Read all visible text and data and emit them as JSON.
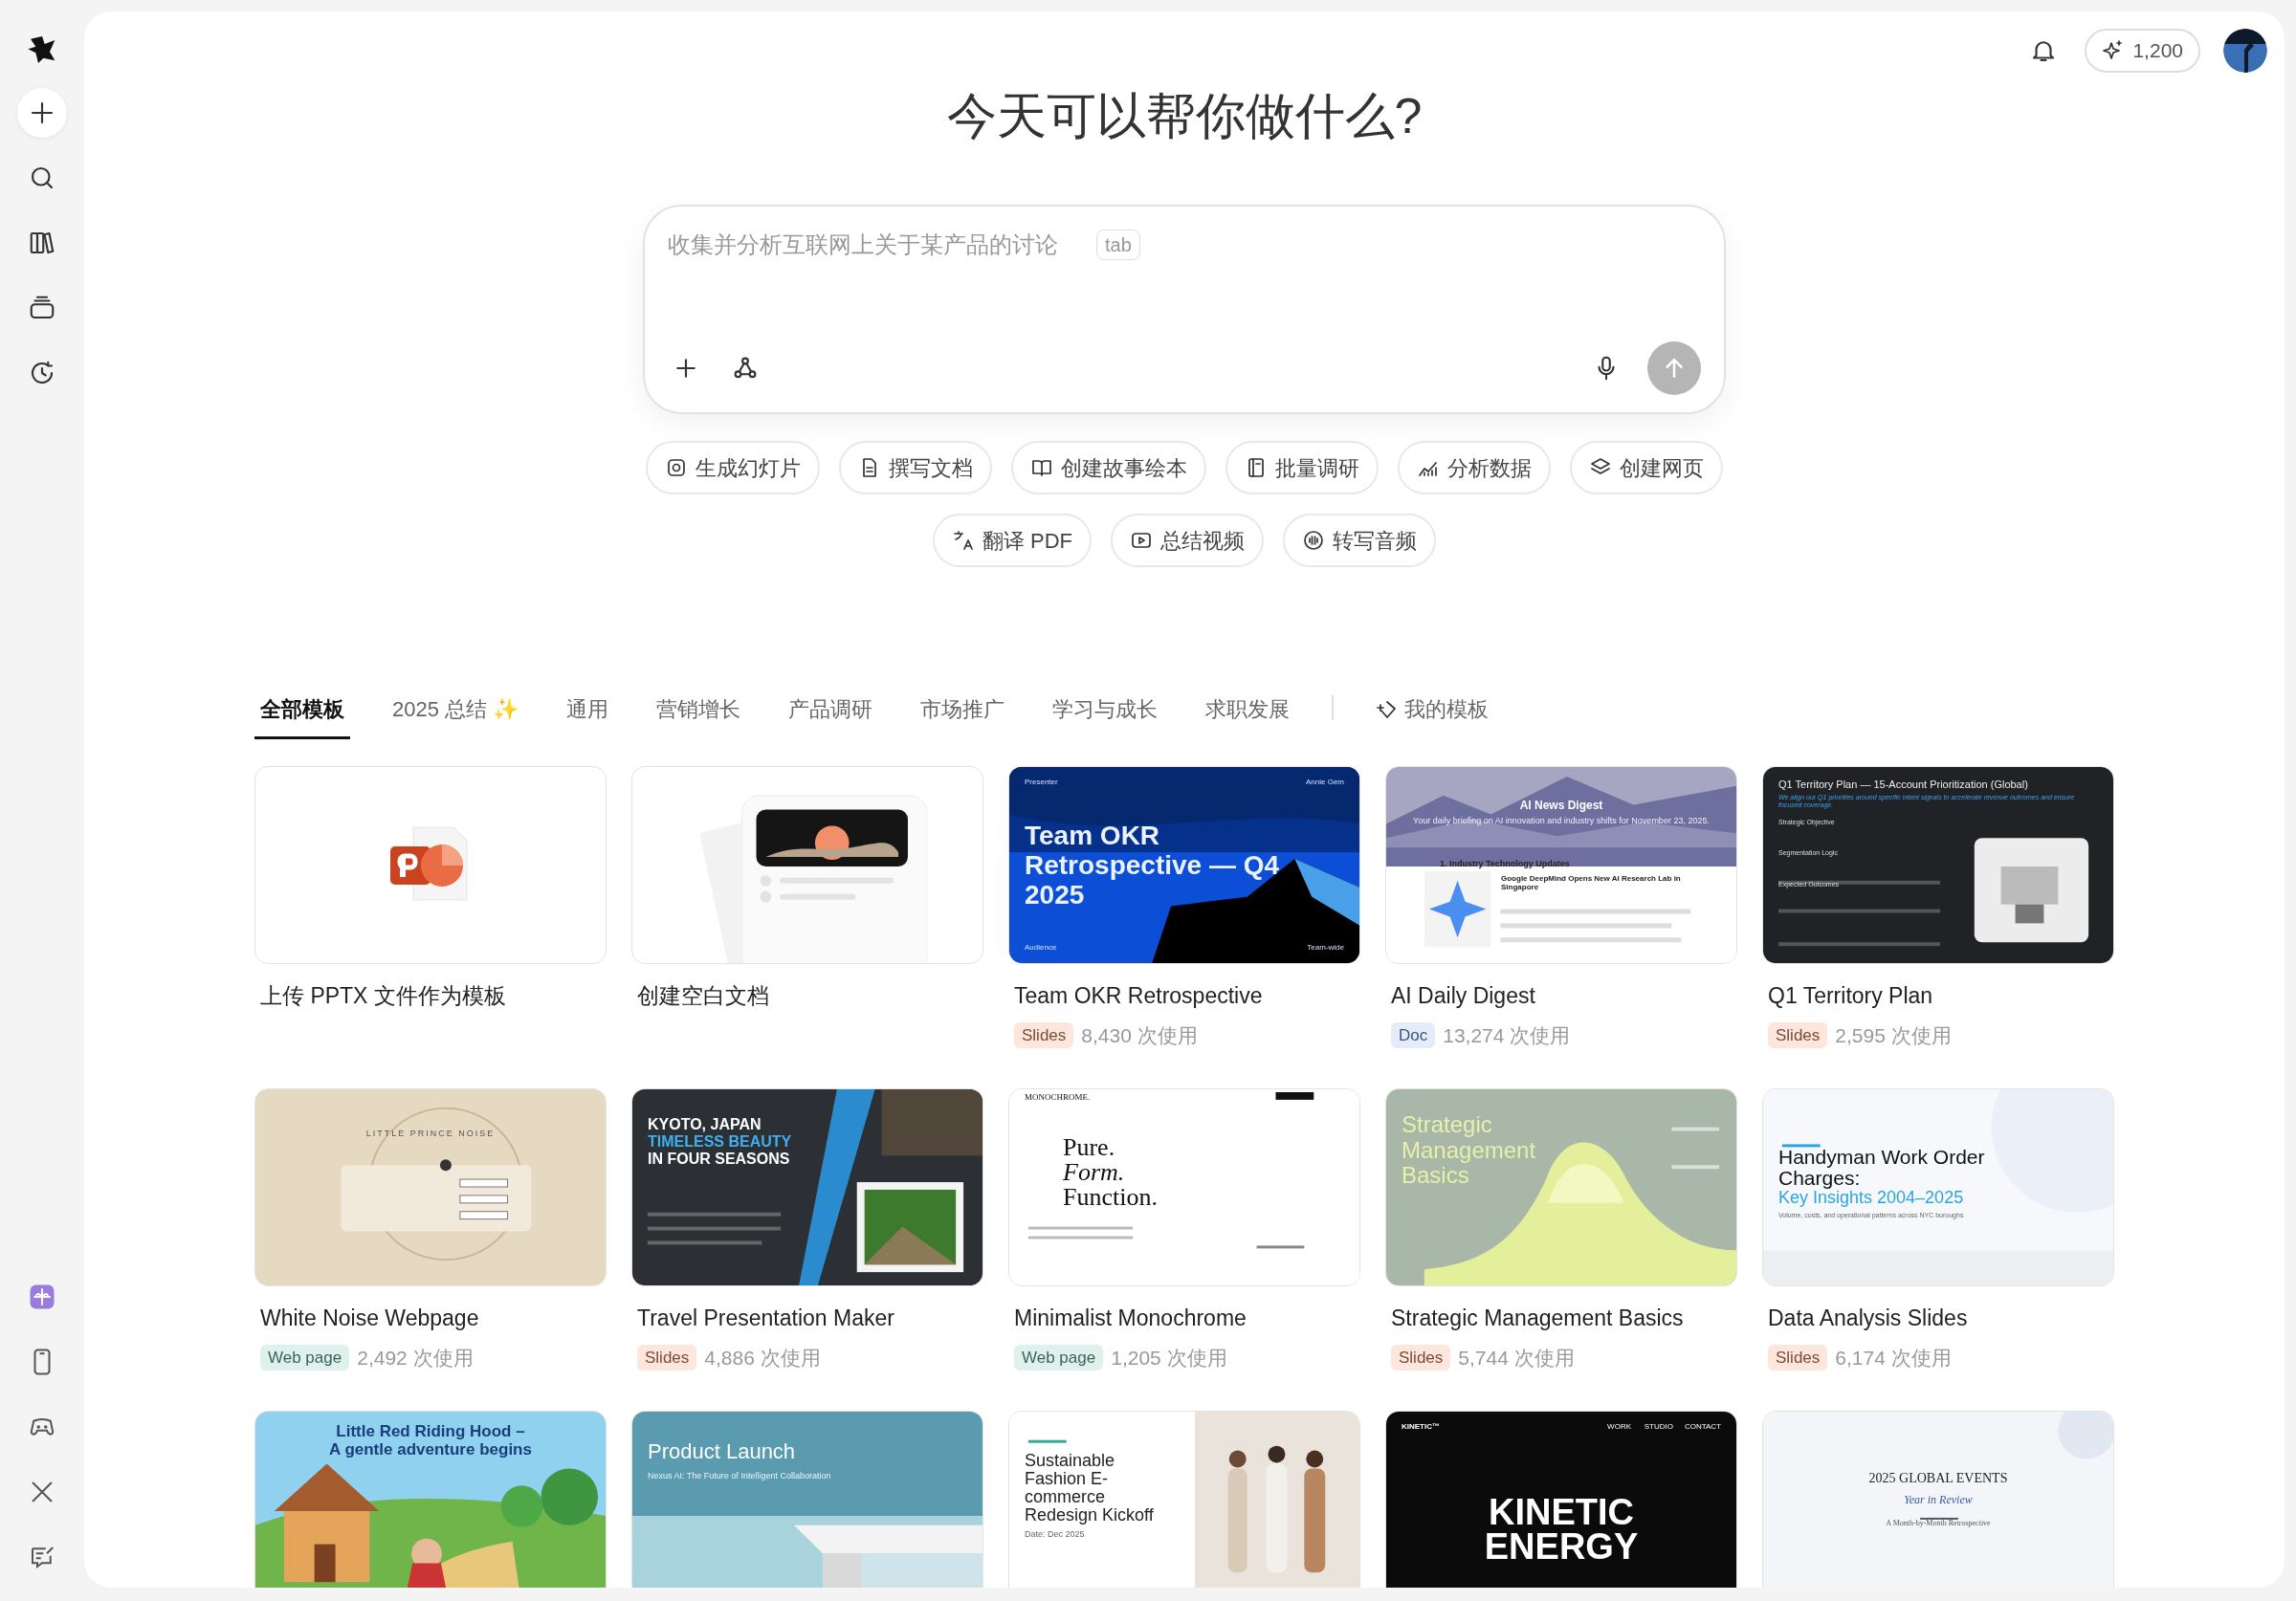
{
  "sidebar": {
    "top": [
      {
        "kind": "logo"
      },
      {
        "kind": "new"
      },
      {
        "kind": "search"
      },
      {
        "kind": "library"
      },
      {
        "kind": "stack"
      },
      {
        "kind": "history"
      }
    ],
    "bottom": [
      {
        "kind": "gift"
      },
      {
        "kind": "phone"
      },
      {
        "kind": "controller"
      },
      {
        "kind": "x"
      },
      {
        "kind": "feedback"
      }
    ]
  },
  "header": {
    "credits": "1,200"
  },
  "heading": "今天可以帮你做什么?",
  "prompt": {
    "placeholder": "收集并分析互联网上关于某产品的讨论",
    "hint_key": "tab"
  },
  "actions": [
    [
      {
        "label": "生成幻灯片",
        "kind": "slides"
      },
      {
        "label": "撰写文档",
        "kind": "doc"
      },
      {
        "label": "创建故事绘本",
        "kind": "story"
      },
      {
        "label": "批量调研",
        "kind": "research"
      },
      {
        "label": "分析数据",
        "kind": "chart"
      },
      {
        "label": "创建网页",
        "kind": "web"
      }
    ],
    [
      {
        "label": "翻译 PDF",
        "kind": "translate"
      },
      {
        "label": "总结视频",
        "kind": "video"
      },
      {
        "label": "转写音频",
        "kind": "audio"
      }
    ]
  ],
  "tabs": [
    {
      "label": "全部模板",
      "selected": true
    },
    {
      "label": "2025 总结 ✨",
      "selected": false
    },
    {
      "label": "通用",
      "selected": false
    },
    {
      "label": "营销增长",
      "selected": false
    },
    {
      "label": "产品调研",
      "selected": false
    },
    {
      "label": "市场推广",
      "selected": false
    },
    {
      "label": "学习与成长",
      "selected": false
    },
    {
      "label": "求职发展",
      "selected": false
    },
    {
      "label": "我的模板",
      "selected": false,
      "kind": "mine"
    }
  ],
  "templates": [
    {
      "title": "上传 PPTX 文件作为模板",
      "thumb": {
        "kind": "upload"
      }
    },
    {
      "title": "创建空白文档",
      "thumb": {
        "kind": "blank"
      }
    },
    {
      "title": "Team OKR Retrospective",
      "tag": {
        "label": "Slides",
        "kind": "slides"
      },
      "uses": "8,430 次使用",
      "thumb": {
        "kind": "okr",
        "lines": [
          "Presenter",
          "Annie Gem",
          "Team OKR Retrospective — Q4 2025",
          "Audience",
          "Team-wide"
        ]
      }
    },
    {
      "title": "AI Daily Digest",
      "tag": {
        "label": "Doc",
        "kind": "doc"
      },
      "uses": "13,274 次使用",
      "thumb": {
        "kind": "digest",
        "lines": [
          "AI News Digest",
          "Your daily briefing on AI innovation and industry shifts for November 23, 2025.",
          "1. Industry Technology Updates",
          "Google DeepMind Opens New AI Research Lab in Singapore"
        ]
      }
    },
    {
      "title": "Q1 Territory Plan",
      "tag": {
        "label": "Slides",
        "kind": "slides"
      },
      "uses": "2,595 次使用",
      "thumb": {
        "kind": "territory",
        "lines": [
          "Q1 Territory Plan — 15-Account Prioritization (Global)",
          "We align our Q1 priorities around specific intent signals to accelerate revenue outcomes and ensure focused coverage.",
          "Strategic Objective",
          "Segmentation Logic",
          "Expected Outcomes"
        ]
      }
    },
    {
      "title": "White Noise Webpage",
      "tag": {
        "label": "Web page",
        "kind": "web"
      },
      "uses": "2,492 次使用",
      "thumb": {
        "kind": "paper",
        "lines": [
          "LITTLE PRINCE NOISE"
        ]
      }
    },
    {
      "title": "Travel Presentation Maker",
      "tag": {
        "label": "Slides",
        "kind": "slides"
      },
      "uses": "4,886 次使用",
      "thumb": {
        "kind": "kyoto",
        "lines": [
          "KYOTO, JAPAN",
          "TIMELESS BEAUTY",
          "IN FOUR SEASONS"
        ]
      }
    },
    {
      "title": "Minimalist Monochrome",
      "tag": {
        "label": "Web page",
        "kind": "web"
      },
      "uses": "1,205 次使用",
      "thumb": {
        "kind": "mono",
        "lines": [
          "MONOCHROME.",
          "Pure.",
          "Form.",
          "Function."
        ]
      }
    },
    {
      "title": "Strategic Management Basics",
      "tag": {
        "label": "Slides",
        "kind": "slides"
      },
      "uses": "5,744 次使用",
      "thumb": {
        "kind": "strategy",
        "lines": [
          "Strategic Management Basics"
        ]
      }
    },
    {
      "title": "Data Analysis Slides",
      "tag": {
        "label": "Slides",
        "kind": "slides"
      },
      "uses": "6,174 次使用",
      "thumb": {
        "kind": "handyman",
        "lines": [
          "Handyman Work Order Charges:",
          "Key Insights 2004–2025",
          "Volume, costs, and operational patterns across NYC boroughs"
        ]
      }
    },
    {
      "thumb": {
        "kind": "story",
        "lines": [
          "Little Red Riding Hood –",
          "A gentle adventure begins"
        ]
      }
    },
    {
      "thumb": {
        "kind": "launch",
        "lines": [
          "Product Launch",
          "Nexus AI: The Future of Intelligent Collaboration"
        ]
      }
    },
    {
      "thumb": {
        "kind": "fashion",
        "lines": [
          "Sustainable Fashion E-commerce Redesign Kickoff",
          "Date: Dec 2025"
        ]
      }
    },
    {
      "thumb": {
        "kind": "kinetic",
        "lines": [
          "KINETIC™",
          "WORK",
          "STUDIO",
          "CONTACT",
          "KINETIC ENERGY"
        ]
      }
    },
    {
      "thumb": {
        "kind": "events",
        "lines": [
          "2025 GLOBAL EVENTS",
          "Year in Review",
          "A Month-by-Month Retrospective"
        ]
      }
    }
  ]
}
